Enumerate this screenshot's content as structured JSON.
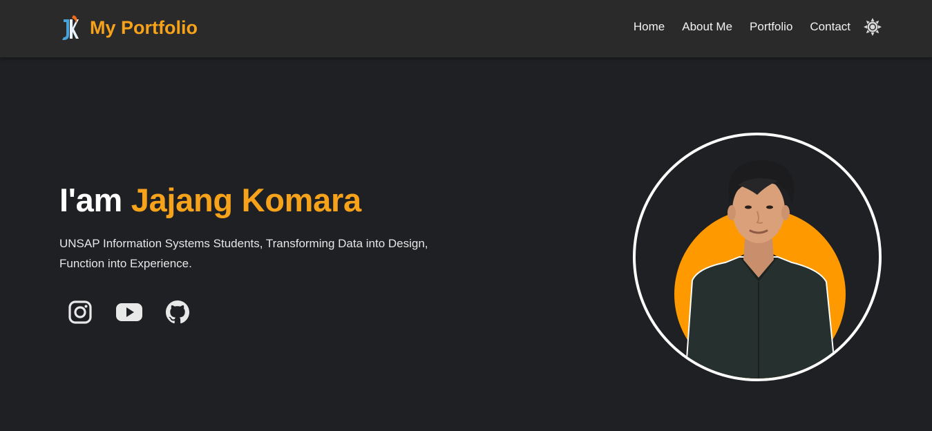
{
  "brand": {
    "title": "My Portfolio",
    "logo_icon": "jk-monogram-logo"
  },
  "nav": {
    "items": [
      {
        "label": "Home"
      },
      {
        "label": "About Me"
      },
      {
        "label": "Portfolio"
      },
      {
        "label": "Contact"
      }
    ]
  },
  "theme_toggle": {
    "icon": "sun-icon"
  },
  "hero": {
    "greeting": "I'am",
    "name": "Jajang Komara",
    "description": "UNSAP Information Systems Students, Transforming Data into Design, Function into Experience."
  },
  "socials": [
    {
      "icon": "instagram-icon"
    },
    {
      "icon": "youtube-icon"
    },
    {
      "icon": "github-icon"
    }
  ],
  "colors": {
    "accent": "#f7a21b",
    "background": "#1f2023",
    "navbar": "#2a2a2a",
    "portrait_circle": "#ff9900"
  }
}
